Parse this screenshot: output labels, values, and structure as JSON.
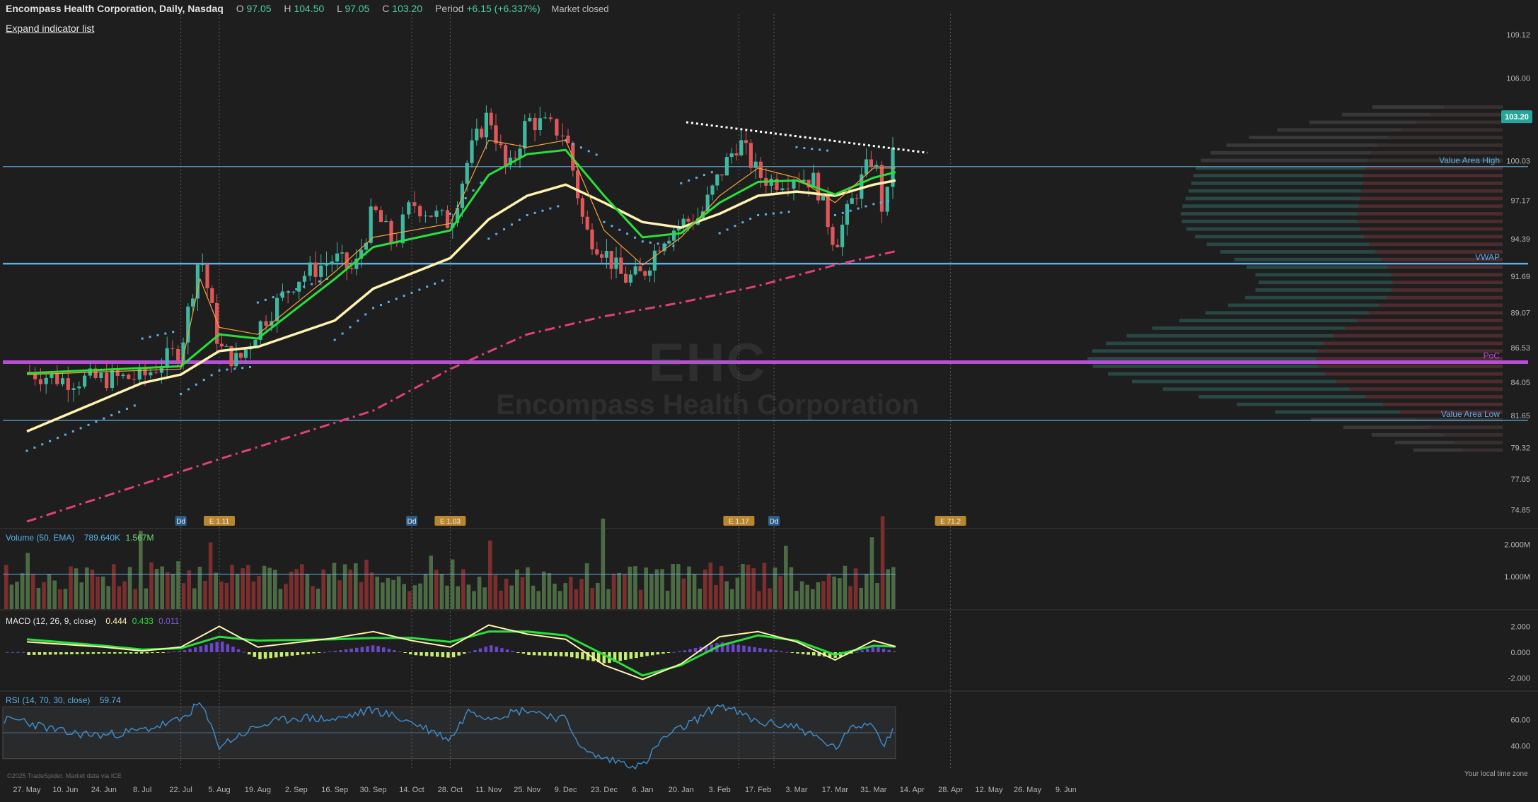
{
  "header": {
    "title": "Encompass Health Corporation, Daily, Nasdaq",
    "open_label": "O",
    "open": "97.05",
    "high_label": "H",
    "high": "104.50",
    "low_label": "L",
    "low": "97.05",
    "close_label": "C",
    "close": "103.20",
    "period_label": "Period",
    "period": "+6.15 (+6.337%)",
    "status": "Market closed"
  },
  "expand_link": "Expand indicator list",
  "watermark": {
    "ticker": "EHC",
    "name": "Encompass Health Corporation"
  },
  "footer": {
    "copyright": "©2025 TradeSpider. Market data via ICE",
    "local_time": "Your local time zone"
  },
  "colors": {
    "background": "#1e1e1e",
    "up": "#3fb8a0",
    "down": "#e0575a",
    "ema_fast": "#f2a23c",
    "ema_mid": "#27e03a",
    "ema_slow": "#fff3b0",
    "sma200": "#e0407a",
    "psar": "#5ab0e8",
    "poc": "#b44fd6",
    "levels": "#5ab0e8"
  },
  "chart_data": [
    {
      "type": "candlestick",
      "title": "Encompass Health Corporation, Daily, Nasdaq",
      "x_tick_labels": [
        "27. May",
        "10. Jun",
        "24. Jun",
        "8. Jul",
        "22. Jul",
        "5. Aug",
        "19. Aug",
        "2. Sep",
        "16. Sep",
        "30. Sep",
        "14. Oct",
        "28. Oct",
        "11. Nov",
        "25. Nov",
        "9. Dec",
        "23. Dec",
        "6. Jan",
        "20. Jan",
        "3. Feb",
        "17. Feb",
        "3. Mar",
        "17. Mar",
        "31. Mar",
        "14. Apr",
        "28. Apr",
        "12. May",
        "26. May",
        "9. Jun"
      ],
      "y_tick_labels": [
        "109.12",
        "106.00",
        "100.03",
        "97.17",
        "94.39",
        "91.69",
        "89.07",
        "86.53",
        "84.05",
        "81.65",
        "79.32",
        "77.05",
        "74.85"
      ],
      "ylim": [
        73.8,
        110.6
      ],
      "last_price": "103.20",
      "price_path": [
        {
          "date": "27. May",
          "value": 84.8
        },
        {
          "date": "10. Jun",
          "value": 84.2
        },
        {
          "date": "24. Jun",
          "value": 84.3
        },
        {
          "date": "8. Jul",
          "value": 84.4
        },
        {
          "date": "22. Jul",
          "value": 86.5
        },
        {
          "date": "29. Jul",
          "value": 93.5
        },
        {
          "date": "5. Aug",
          "value": 86.5
        },
        {
          "date": "12. Aug",
          "value": 85.5
        },
        {
          "date": "19. Aug",
          "value": 88.0
        },
        {
          "date": "2. Sep",
          "value": 91.5
        },
        {
          "date": "16. Sep",
          "value": 93.0
        },
        {
          "date": "23. Sep",
          "value": 92.0
        },
        {
          "date": "30. Sep",
          "value": 96.5
        },
        {
          "date": "7. Oct",
          "value": 94.0
        },
        {
          "date": "14. Oct",
          "value": 97.0
        },
        {
          "date": "28. Oct",
          "value": 95.5
        },
        {
          "date": "4. Nov",
          "value": 100.5
        },
        {
          "date": "11. Nov",
          "value": 103.5
        },
        {
          "date": "18. Nov",
          "value": 99.0
        },
        {
          "date": "25. Nov",
          "value": 103.0
        },
        {
          "date": "2. Dec",
          "value": 102.5
        },
        {
          "date": "9. Dec",
          "value": 102.0
        },
        {
          "date": "16. Dec",
          "value": 95.0
        },
        {
          "date": "23. Dec",
          "value": 93.5
        },
        {
          "date": "30. Dec",
          "value": 91.5
        },
        {
          "date": "6. Jan",
          "value": 91.8
        },
        {
          "date": "13. Jan",
          "value": 94.5
        },
        {
          "date": "20. Jan",
          "value": 95.5
        },
        {
          "date": "27. Jan",
          "value": 96.0
        },
        {
          "date": "3. Feb",
          "value": 99.0
        },
        {
          "date": "10. Feb",
          "value": 101.5
        },
        {
          "date": "17. Feb",
          "value": 99.0
        },
        {
          "date": "24. Feb",
          "value": 98.5
        },
        {
          "date": "3. Mar",
          "value": 99.0
        },
        {
          "date": "10. Mar",
          "value": 98.5
        },
        {
          "date": "17. Mar",
          "value": 94.0
        },
        {
          "date": "24. Mar",
          "value": 97.5
        },
        {
          "date": "31. Mar",
          "value": 100.5
        },
        {
          "date": "4. Apr",
          "value": 95.5
        },
        {
          "date": "8. Apr",
          "value": 103.2
        }
      ],
      "overlays": {
        "ema_fast": [
          {
            "date": "27. May",
            "value": 84.6
          },
          {
            "date": "22. Jul",
            "value": 85.0
          },
          {
            "date": "29. Jul",
            "value": 91.5
          },
          {
            "date": "5. Aug",
            "value": 88.0
          },
          {
            "date": "19. Aug",
            "value": 87.5
          },
          {
            "date": "16. Sep",
            "value": 92.0
          },
          {
            "date": "30. Sep",
            "value": 94.5
          },
          {
            "date": "28. Oct",
            "value": 95.5
          },
          {
            "date": "11. Nov",
            "value": 101.5
          },
          {
            "date": "25. Nov",
            "value": 101.0
          },
          {
            "date": "9. Dec",
            "value": 101.5
          },
          {
            "date": "23. Dec",
            "value": 95.0
          },
          {
            "date": "6. Jan",
            "value": 92.5
          },
          {
            "date": "20. Jan",
            "value": 94.5
          },
          {
            "date": "3. Feb",
            "value": 97.5
          },
          {
            "date": "17. Feb",
            "value": 99.5
          },
          {
            "date": "3. Mar",
            "value": 98.8
          },
          {
            "date": "17. Mar",
            "value": 97.0
          },
          {
            "date": "31. Mar",
            "value": 99.5
          },
          {
            "date": "8. Apr",
            "value": 99.5
          }
        ],
        "ema_mid": [
          {
            "date": "27. May",
            "value": 84.7
          },
          {
            "date": "22. Jul",
            "value": 85.2
          },
          {
            "date": "5. Aug",
            "value": 87.5
          },
          {
            "date": "19. Aug",
            "value": 87.2
          },
          {
            "date": "16. Sep",
            "value": 91.5
          },
          {
            "date": "30. Sep",
            "value": 93.8
          },
          {
            "date": "28. Oct",
            "value": 95.0
          },
          {
            "date": "11. Nov",
            "value": 99.0
          },
          {
            "date": "25. Nov",
            "value": 100.5
          },
          {
            "date": "9. Dec",
            "value": 100.8
          },
          {
            "date": "23. Dec",
            "value": 97.5
          },
          {
            "date": "6. Jan",
            "value": 94.5
          },
          {
            "date": "20. Jan",
            "value": 94.8
          },
          {
            "date": "3. Feb",
            "value": 97.0
          },
          {
            "date": "17. Feb",
            "value": 98.5
          },
          {
            "date": "3. Mar",
            "value": 98.6
          },
          {
            "date": "17. Mar",
            "value": 97.6
          },
          {
            "date": "31. Mar",
            "value": 98.8
          },
          {
            "date": "8. Apr",
            "value": 99.2
          }
        ],
        "ema_slow": [
          {
            "date": "27. May",
            "value": 80.5
          },
          {
            "date": "8. Jul",
            "value": 84.0
          },
          {
            "date": "22. Jul",
            "value": 84.6
          },
          {
            "date": "5. Aug",
            "value": 86.3
          },
          {
            "date": "19. Aug",
            "value": 86.6
          },
          {
            "date": "16. Sep",
            "value": 88.5
          },
          {
            "date": "30. Sep",
            "value": 90.8
          },
          {
            "date": "28. Oct",
            "value": 93.0
          },
          {
            "date": "11. Nov",
            "value": 95.8
          },
          {
            "date": "25. Nov",
            "value": 97.5
          },
          {
            "date": "9. Dec",
            "value": 98.3
          },
          {
            "date": "23. Dec",
            "value": 97.0
          },
          {
            "date": "6. Jan",
            "value": 95.6
          },
          {
            "date": "20. Jan",
            "value": 95.2
          },
          {
            "date": "3. Feb",
            "value": 96.2
          },
          {
            "date": "17. Feb",
            "value": 97.5
          },
          {
            "date": "3. Mar",
            "value": 97.8
          },
          {
            "date": "17. Mar",
            "value": 97.5
          },
          {
            "date": "31. Mar",
            "value": 98.3
          },
          {
            "date": "8. Apr",
            "value": 98.6
          }
        ],
        "sma200": [
          {
            "date": "27. May",
            "value": 74.0
          },
          {
            "date": "5. Aug",
            "value": 78.5
          },
          {
            "date": "30. Sep",
            "value": 82.0
          },
          {
            "date": "28. Oct",
            "value": 85.0
          },
          {
            "date": "25. Nov",
            "value": 87.5
          },
          {
            "date": "23. Dec",
            "value": 88.8
          },
          {
            "date": "20. Jan",
            "value": 89.8
          },
          {
            "date": "17. Feb",
            "value": 91.0
          },
          {
            "date": "17. Mar",
            "value": 92.5
          },
          {
            "date": "8. Apr",
            "value": 93.5
          }
        ]
      },
      "horizontal_levels": [
        {
          "label": "Value Area High",
          "value": 99.6
        },
        {
          "label": "VWAP",
          "value": 92.6
        },
        {
          "label": "PoC",
          "value": 85.5
        },
        {
          "label": "Value Area Low",
          "value": 81.3
        }
      ],
      "trendline": {
        "from": {
          "date": "27. Jan",
          "value": 102.8
        },
        "to": {
          "date": "8. Apr",
          "value": 100.6
        }
      },
      "event_badges": [
        {
          "label": "Dd",
          "date": "22. Jul"
        },
        {
          "label": "E 1.11",
          "date": "5. Aug"
        },
        {
          "label": "Dd",
          "date": "14. Oct"
        },
        {
          "label": "E 1.03",
          "date": "28. Oct"
        },
        {
          "label": "E 1.17",
          "date": "10. Feb"
        },
        {
          "label": "Dd",
          "date": "24. Feb"
        },
        {
          "label": "E 71.2",
          "date": "28. Apr"
        }
      ]
    },
    {
      "type": "bar",
      "title": "Volume (50, EMA)",
      "legend_values": [
        "789.640K",
        "1.567M"
      ],
      "y_tick_labels": [
        "2.000M",
        "1.000M"
      ],
      "ylim": [
        0,
        2400000
      ],
      "volume_level": 0.45
    },
    {
      "type": "line",
      "title": "MACD (12, 26, 9, close)",
      "legend_values": [
        "0.444",
        "0.433",
        "0.011"
      ],
      "y_tick_labels": [
        "2.000",
        "0.000",
        "-2.000"
      ],
      "ylim": [
        -2.9,
        2.9
      ],
      "macd": [
        {
          "date": "27. May",
          "value": 0.8
        },
        {
          "date": "24. Jun",
          "value": 0.4
        },
        {
          "date": "8. Jul",
          "value": 0.1
        },
        {
          "date": "22. Jul",
          "value": 0.4
        },
        {
          "date": "5. Aug",
          "value": 2.0
        },
        {
          "date": "19. Aug",
          "value": 0.4
        },
        {
          "date": "16. Sep",
          "value": 1.1
        },
        {
          "date": "30. Sep",
          "value": 1.6
        },
        {
          "date": "14. Oct",
          "value": 0.9
        },
        {
          "date": "28. Oct",
          "value": 0.4
        },
        {
          "date": "11. Nov",
          "value": 2.1
        },
        {
          "date": "25. Nov",
          "value": 1.4
        },
        {
          "date": "9. Dec",
          "value": 1.0
        },
        {
          "date": "23. Dec",
          "value": -1.0
        },
        {
          "date": "6. Jan",
          "value": -2.1
        },
        {
          "date": "20. Jan",
          "value": -0.9
        },
        {
          "date": "3. Feb",
          "value": 1.2
        },
        {
          "date": "17. Feb",
          "value": 1.6
        },
        {
          "date": "3. Mar",
          "value": 0.8
        },
        {
          "date": "17. Mar",
          "value": -0.6
        },
        {
          "date": "31. Mar",
          "value": 0.9
        },
        {
          "date": "8. Apr",
          "value": 0.44
        }
      ],
      "signal": [
        {
          "date": "27. May",
          "value": 1.0
        },
        {
          "date": "24. Jun",
          "value": 0.5
        },
        {
          "date": "8. Jul",
          "value": 0.2
        },
        {
          "date": "22. Jul",
          "value": 0.3
        },
        {
          "date": "5. Aug",
          "value": 1.2
        },
        {
          "date": "19. Aug",
          "value": 0.9
        },
        {
          "date": "16. Sep",
          "value": 1.0
        },
        {
          "date": "30. Sep",
          "value": 1.1
        },
        {
          "date": "14. Oct",
          "value": 1.1
        },
        {
          "date": "28. Oct",
          "value": 0.8
        },
        {
          "date": "11. Nov",
          "value": 1.6
        },
        {
          "date": "25. Nov",
          "value": 1.6
        },
        {
          "date": "9. Dec",
          "value": 1.3
        },
        {
          "date": "23. Dec",
          "value": -0.2
        },
        {
          "date": "6. Jan",
          "value": -1.8
        },
        {
          "date": "20. Jan",
          "value": -1.0
        },
        {
          "date": "3. Feb",
          "value": 0.5
        },
        {
          "date": "17. Feb",
          "value": 1.3
        },
        {
          "date": "3. Mar",
          "value": 0.9
        },
        {
          "date": "17. Mar",
          "value": -0.2
        },
        {
          "date": "31. Mar",
          "value": 0.5
        },
        {
          "date": "8. Apr",
          "value": 0.43
        }
      ]
    },
    {
      "type": "line",
      "title": "RSI (14, 70, 30, close)",
      "legend_values": [
        "59.74"
      ],
      "y_tick_labels": [
        "60.00",
        "40.00"
      ],
      "ylim": [
        20,
        80
      ],
      "bands": [
        30,
        70
      ],
      "rsi": [
        {
          "date": "27. May",
          "value": 58
        },
        {
          "date": "10. Jun",
          "value": 50
        },
        {
          "date": "24. Jun",
          "value": 48
        },
        {
          "date": "8. Jul",
          "value": 52
        },
        {
          "date": "22. Jul",
          "value": 60
        },
        {
          "date": "29. Jul",
          "value": 73
        },
        {
          "date": "5. Aug",
          "value": 40
        },
        {
          "date": "19. Aug",
          "value": 55
        },
        {
          "date": "2. Sep",
          "value": 62
        },
        {
          "date": "16. Sep",
          "value": 60
        },
        {
          "date": "30. Sep",
          "value": 68
        },
        {
          "date": "14. Oct",
          "value": 58
        },
        {
          "date": "28. Oct",
          "value": 45
        },
        {
          "date": "4. Nov",
          "value": 68
        },
        {
          "date": "11. Nov",
          "value": 62
        },
        {
          "date": "25. Nov",
          "value": 68
        },
        {
          "date": "9. Dec",
          "value": 60
        },
        {
          "date": "16. Dec",
          "value": 35
        },
        {
          "date": "23. Dec",
          "value": 30
        },
        {
          "date": "6. Jan",
          "value": 24
        },
        {
          "date": "13. Jan",
          "value": 45
        },
        {
          "date": "27. Jan",
          "value": 62
        },
        {
          "date": "3. Feb",
          "value": 72
        },
        {
          "date": "17. Feb",
          "value": 58
        },
        {
          "date": "3. Mar",
          "value": 55
        },
        {
          "date": "17. Mar",
          "value": 38
        },
        {
          "date": "24. Mar",
          "value": 55
        },
        {
          "date": "31. Mar",
          "value": 58
        },
        {
          "date": "4. Apr",
          "value": 40
        },
        {
          "date": "8. Apr",
          "value": 59.74
        }
      ]
    }
  ]
}
